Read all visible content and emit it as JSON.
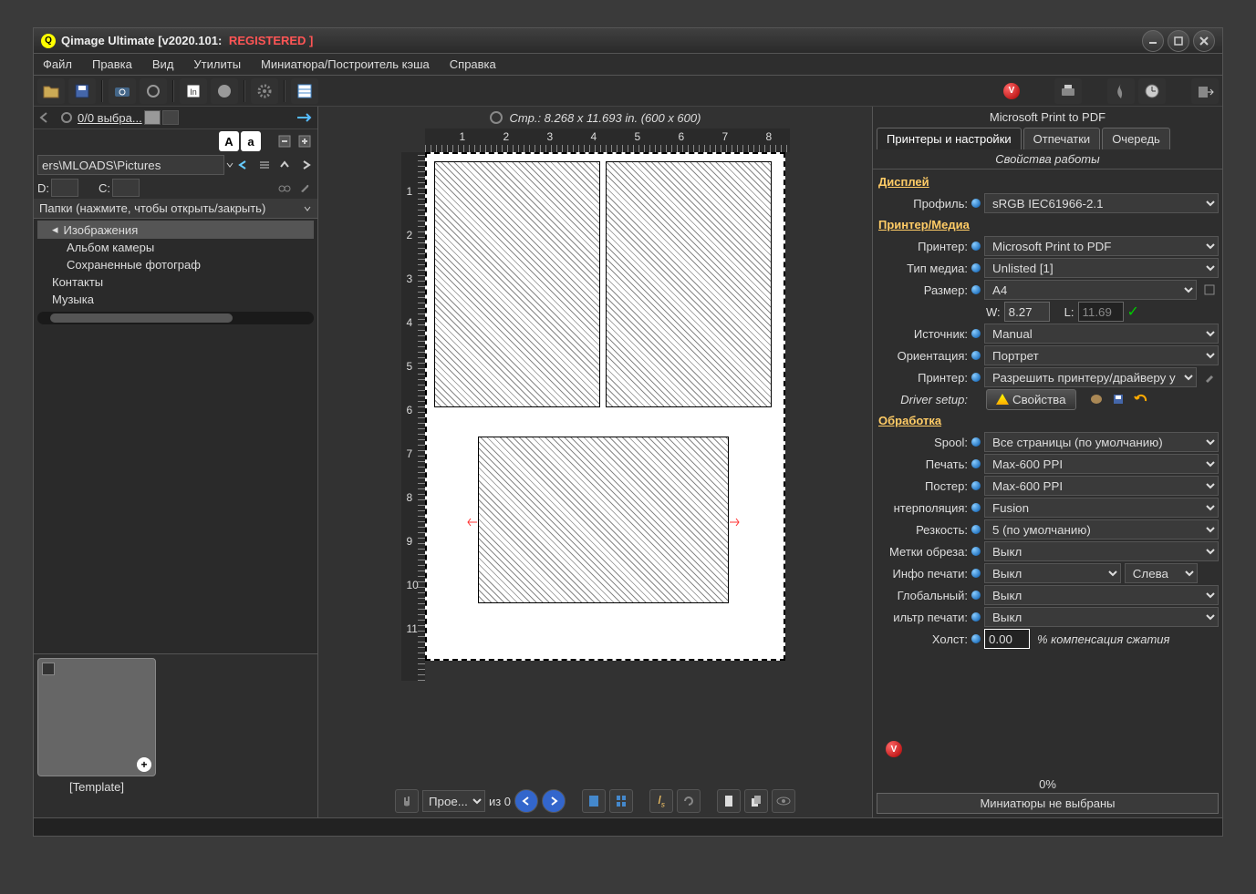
{
  "title": {
    "app": "Qimage Ultimate [v2020.101:",
    "reg": "  REGISTERED ]"
  },
  "menu": [
    "Файл",
    "Правка",
    "Вид",
    "Утилиты",
    "Миниатюра/Построитель кэша",
    "Справка"
  ],
  "left": {
    "selected_count": "0/0 выбра...",
    "path_value": "ers\\MLOADS\\Pictures",
    "drive_d": "D:",
    "drive_c": "C:",
    "folder_header": "Папки (нажмите, чтобы открыть/закрыть)",
    "tree": {
      "selected": "Изображения",
      "items": [
        "Альбом камеры",
        "Сохраненные фотограф",
        "Контакты",
        "Музыка"
      ]
    },
    "thumb_label": "[Template]"
  },
  "center": {
    "page_info": "Стр.: 8.268 x 11.693 in.  (600 x 600)",
    "page_select": "Прое...",
    "from_label": "из 0"
  },
  "right": {
    "printer": "Microsoft Print to PDF",
    "tabs": [
      "Принтеры и настройки",
      "Отпечатки",
      "Очередь"
    ],
    "work_header": "Свойства работы",
    "sections": {
      "display": {
        "title": "Дисплей",
        "profile_label": "Профиль:",
        "profile_value": "sRGB IEC61966-2.1"
      },
      "printer_media": {
        "title": "Принтер/Медиа",
        "printer_label": "Принтер:",
        "printer_value": "Microsoft Print to PDF",
        "media_label": "Тип медиа:",
        "media_value": "Unlisted [1]",
        "size_label": "Размер:",
        "size_value": "A4",
        "w_label": "W:",
        "w_value": "8.27",
        "l_label": "L:",
        "l_value": "11.69",
        "source_label": "Источник:",
        "source_value": "Manual",
        "orient_label": "Ориентация:",
        "orient_value": "Портрет",
        "printer2_label": "Принтер:",
        "printer2_value": "Разрешить принтеру/драйверу у",
        "driver_label": "Driver setup:",
        "driver_btn": "Свойства"
      },
      "processing": {
        "title": "Обработка",
        "spool_label": "Spool:",
        "spool_value": "Все страницы (по умолчанию)",
        "print_label": "Печать:",
        "print_value": "Max-600 PPI",
        "poster_label": "Постер:",
        "poster_value": "Max-600 PPI",
        "interp_label": "нтерполяция:",
        "interp_value": "Fusion",
        "sharp_label": "Резкость:",
        "sharp_value": "5 (по умолчанию)",
        "crop_label": "Метки обреза:",
        "crop_value": "Выкл",
        "info_label": "Инфо печати:",
        "info_value": "Выкл",
        "info_side": "Слева",
        "global_label": "Глобальный:",
        "global_value": "Выкл",
        "filter_label": "ильтр печати:",
        "filter_value": "Выкл",
        "canvas_label": "Холст:",
        "canvas_value": "0.00",
        "canvas_suffix": "% компенсация сжатия"
      }
    },
    "percent": "0%",
    "mini_bar": "Миниатюры не выбраны"
  }
}
